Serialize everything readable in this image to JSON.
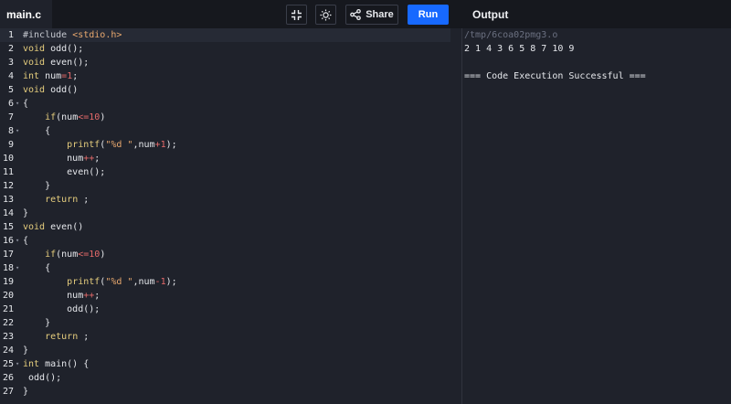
{
  "header": {
    "file_tab": "main.c",
    "share_label": "Share",
    "run_label": "Run",
    "output_title": "Output",
    "icons": {
      "minimize": "compress-icon",
      "theme": "sun-icon",
      "share": "share-nodes-icon"
    }
  },
  "colors": {
    "run_button": "#1769ff",
    "keyword": "#e5cd7d",
    "number": "#e56a6a",
    "string": "#e8a86e"
  },
  "code": {
    "lines": [
      "#include <stdio.h>",
      "void odd();",
      "void even();",
      "int num=1;",
      "void odd()",
      "{",
      "    if(num<=10)",
      "    {",
      "        printf(\"%d \",num+1);",
      "        num++;",
      "        even();",
      "    }",
      "    return ;",
      "}",
      "void even()",
      "{",
      "    if(num<=10)",
      "    {",
      "        printf(\"%d \",num-1);",
      "        num++;",
      "        odd();",
      "    }",
      "    return ;",
      "}",
      "int main() {",
      " odd();",
      "}"
    ],
    "fold_lines": [
      6,
      8,
      16,
      18,
      25
    ],
    "active_line": 1
  },
  "output": {
    "lines": [
      "/tmp/6coa02pmg3.o",
      "2 1 4 3 6 5 8 7 10 9",
      "",
      "=== Code Execution Successful ==="
    ]
  }
}
